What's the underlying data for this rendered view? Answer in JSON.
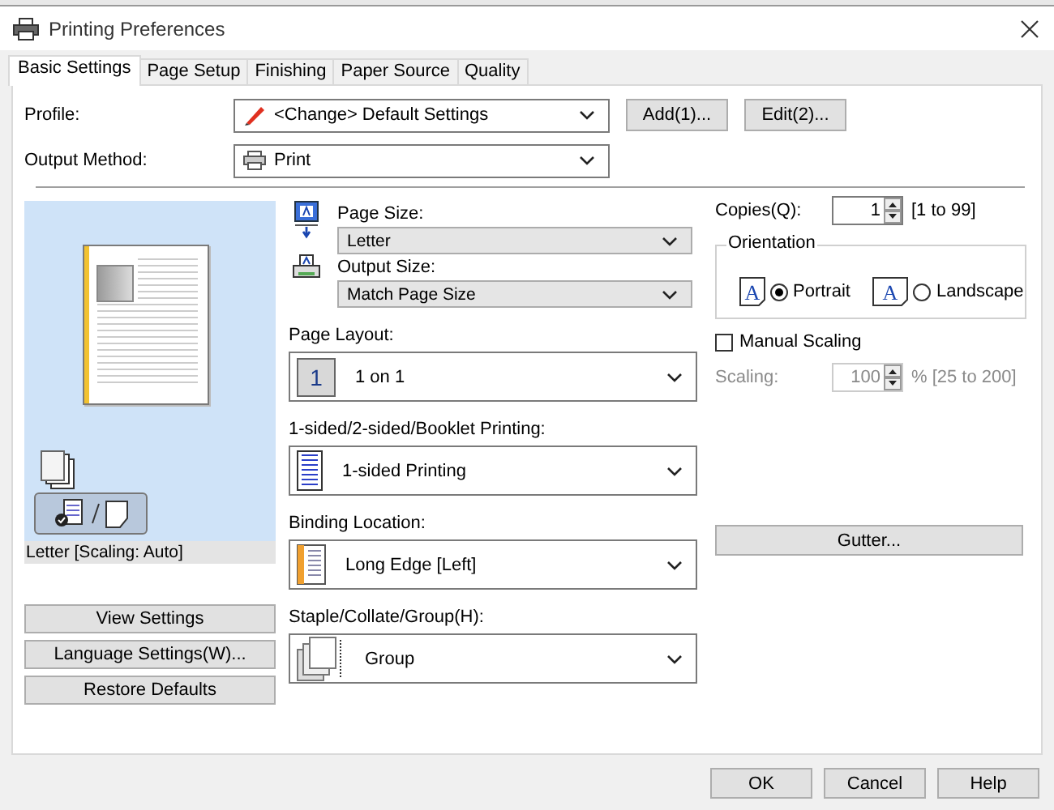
{
  "window": {
    "title": "Printing Preferences"
  },
  "tabs": [
    {
      "label": "Basic Settings",
      "selected": true
    },
    {
      "label": "Page Setup",
      "selected": false
    },
    {
      "label": "Finishing",
      "selected": false
    },
    {
      "label": "Paper Source",
      "selected": false
    },
    {
      "label": "Quality",
      "selected": false
    }
  ],
  "profile": {
    "label": "Profile:",
    "value": "<Change> Default Settings",
    "buttons": [
      "Add(1)...",
      "Edit(2)..."
    ]
  },
  "output_method": {
    "label": "Output Method:",
    "value": "Print"
  },
  "preview": {
    "caption": "Letter [Scaling: Auto]"
  },
  "left_buttons": [
    "View Settings",
    "Language Settings(W)...",
    "Restore Defaults"
  ],
  "paper": [
    {
      "kind": "pagesize",
      "label": "Page Size:",
      "value": "Letter"
    },
    {
      "kind": "outputsize",
      "label": "Output Size:",
      "value": "Match Page Size"
    }
  ],
  "layout_settings": [
    {
      "kind": "layout",
      "label": "Page Layout:",
      "value": "1 on 1",
      "icon_text": "1"
    },
    {
      "kind": "sided",
      "label": "1-sided/2-sided/Booklet Printing:",
      "value": "1-sided Printing"
    },
    {
      "kind": "binding",
      "label": "Binding Location:",
      "value": "Long Edge [Left]"
    },
    {
      "kind": "staple",
      "label": "Staple/Collate/Group(H):",
      "value": "Group"
    }
  ],
  "copies": {
    "label": "Copies(Q):",
    "value": "1",
    "range": "[1 to 99]"
  },
  "orientation": {
    "title": "Orientation",
    "options": [
      {
        "label": "Portrait",
        "selected": true,
        "icon_text": "A"
      },
      {
        "label": "Landscape",
        "selected": false,
        "icon_text": "A"
      }
    ]
  },
  "manual_scaling": {
    "label": "Manual Scaling",
    "checked": false
  },
  "scaling": {
    "label": "Scaling:",
    "value": "100",
    "range": "% [25 to 200]",
    "disabled": true
  },
  "gutter_button": "Gutter...",
  "footer_buttons": [
    "OK",
    "Cancel",
    "Help"
  ]
}
